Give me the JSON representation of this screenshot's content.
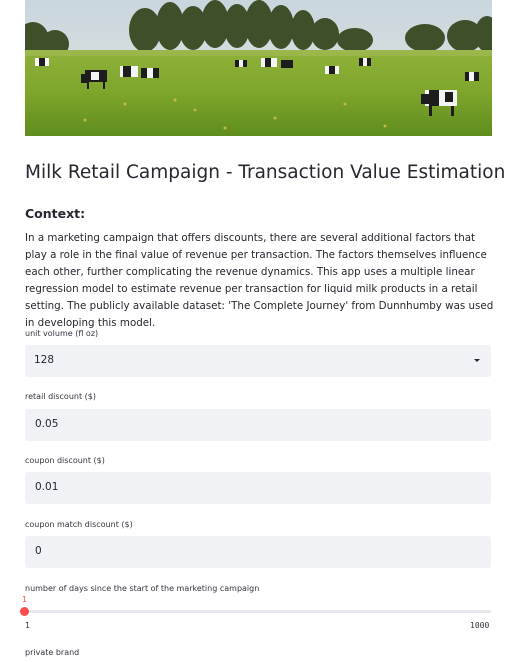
{
  "banner": {
    "icon": "cows-grazing-image"
  },
  "title": "Milk Retail Campaign - Transaction Value Estimation",
  "context": {
    "heading": "Context:",
    "body": "In a marketing campaign that offers discounts, there are several additional factors that play a role in the final value of revenue per transaction. The factors themselves influence each other, further complicating the revenue dynamics. This app uses a multiple linear regression model to estimate revenue per transaction for liquid milk products in a retail setting. The publicly available dataset: 'The Complete Journey' from Dunnhumby was used in developing this model."
  },
  "inputs": {
    "unit_volume": {
      "label": "unit volume (fl oz)",
      "value": "128"
    },
    "retail_discount": {
      "label": "retail discount ($)",
      "value": "0.05"
    },
    "coupon_discount": {
      "label": "coupon discount ($)",
      "value": "0.01"
    },
    "coupon_match_discount": {
      "label": "coupon match discount ($)",
      "value": "0"
    },
    "days_slider": {
      "label": "number of days since the start of the marketing campaign",
      "current": "1",
      "min": "1",
      "max": "1000",
      "fraction": 0.0
    },
    "private_brand": {
      "label": "private brand"
    }
  },
  "colors": {
    "accent": "#ff4b4b",
    "input_bg": "#f0f2f6",
    "text": "#262730"
  }
}
